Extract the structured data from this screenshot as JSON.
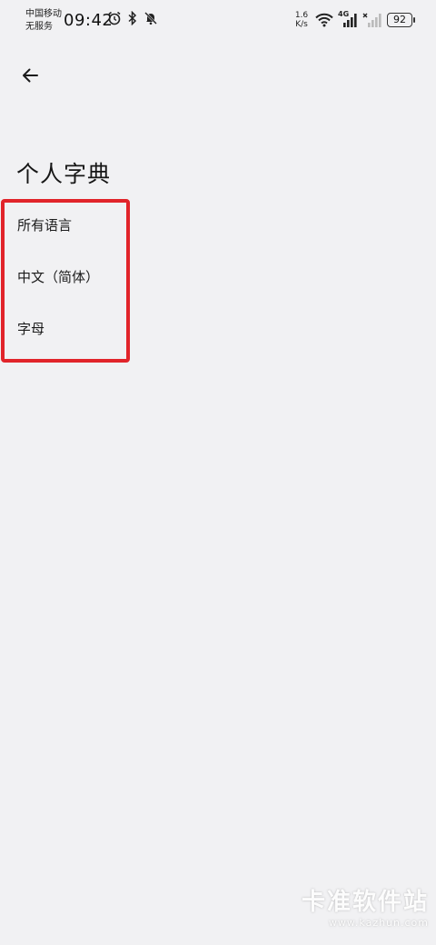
{
  "status_bar": {
    "carrier_line1": "中国移动",
    "carrier_line2": "无服务",
    "time": "09:42",
    "net_speed_value": "1.6",
    "net_speed_unit": "K/s",
    "network_type": "4G",
    "battery_level": "92",
    "icons": [
      "alarm-icon",
      "bluetooth-icon",
      "mute-icon",
      "wifi-icon",
      "signal-icon",
      "no-signal-icon",
      "battery-icon"
    ]
  },
  "header": {
    "back_icon": "arrow-left-icon",
    "title": "个人字典"
  },
  "languages": [
    {
      "label": "所有语言"
    },
    {
      "label": "中文（简体）"
    },
    {
      "label": "字母"
    }
  ],
  "highlight_color": "#e1242a",
  "watermark": {
    "main": "卡准软件站",
    "url": "www.kazhun.com"
  }
}
